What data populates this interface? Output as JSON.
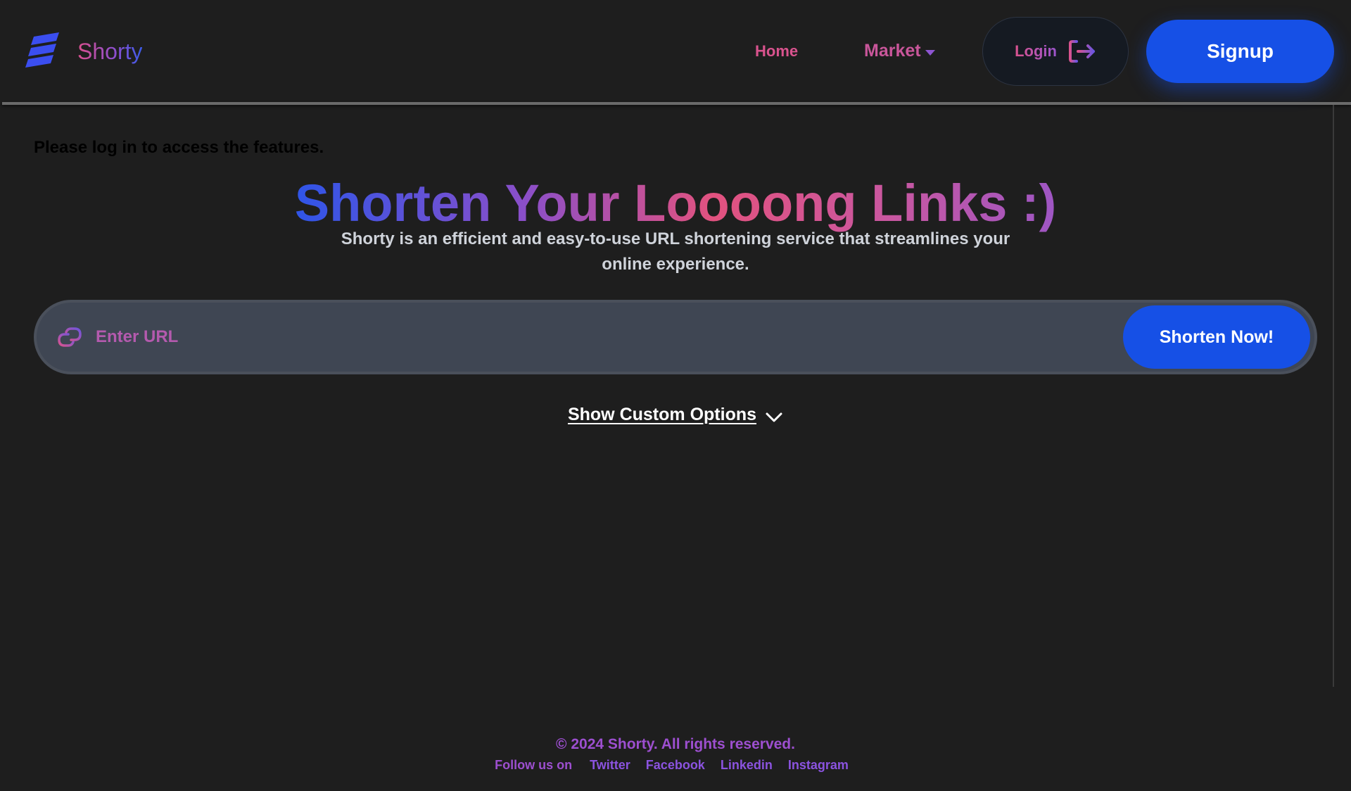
{
  "header": {
    "brand_name": "Shorty",
    "nav": {
      "home": "Home",
      "market": "Market"
    },
    "login_label": "Login",
    "signup_label": "Signup"
  },
  "main": {
    "login_notice": "Please log in to access the features.",
    "title": "Shorten Your Loooong Links :)",
    "subtitle": "Shorty is an efficient and easy-to-use URL shortening service that streamlines your online experience.",
    "url_input": {
      "placeholder": "Enter URL",
      "value": ""
    },
    "shorten_label": "Shorten Now!",
    "custom_options_label": "Show Custom Options"
  },
  "footer": {
    "copyright": "© 2024 Shorty. All rights reserved.",
    "follow_label": "Follow us on",
    "social": [
      "Twitter",
      "Facebook",
      "Linkedin",
      "Instagram"
    ]
  },
  "colors": {
    "background": "#1e1e1e",
    "primary_button": "#1650e6",
    "accent_pink": "#d9538e",
    "accent_purple": "#9d4fd0",
    "accent_blue": "#2f55e8",
    "input_bar": "#3f4653"
  },
  "icons": {
    "brand": "stacked-stripes-logo-icon",
    "market_caret": "caret-down-icon",
    "login": "logout-arrow-icon",
    "url": "link-icon",
    "custom_options": "chevron-down-icon"
  }
}
